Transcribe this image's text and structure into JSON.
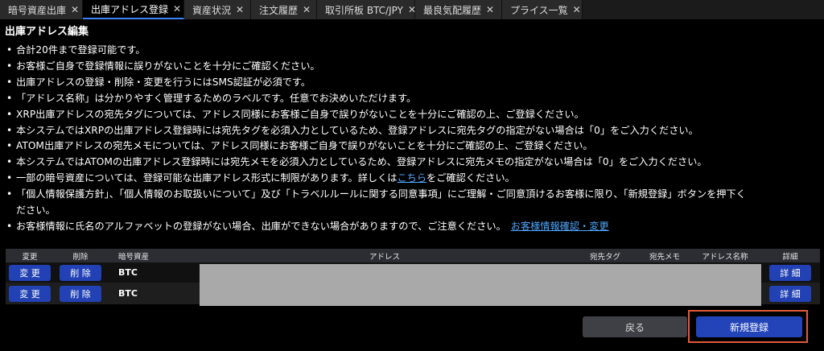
{
  "tabs": [
    {
      "label": "暗号資産出庫",
      "close": "✕",
      "active": false
    },
    {
      "label": "出庫アドレス登録",
      "close": "✕",
      "active": true
    },
    {
      "label": "資産状況",
      "close": "✕",
      "active": false
    },
    {
      "label": "注文履歴",
      "close": "✕",
      "active": false
    },
    {
      "label": "取引所板 BTC/JPY",
      "close": "✕",
      "active": false
    },
    {
      "label": "最良気配履歴",
      "close": "✕",
      "active": false
    },
    {
      "label": "プライス一覧",
      "close": "✕",
      "active": false
    }
  ],
  "title": "出庫アドレス編集",
  "notes": [
    "合計20件まで登録可能です。",
    "お客様ご自身で登録情報に誤りがないことを十分にご確認ください。",
    "出庫アドレスの登録・削除・変更を行うにはSMS認証が必須です。",
    "「アドレス名称」は分かりやすく管理するためのラベルです。任意でお決めいただけます。",
    "XRP出庫アドレスの宛先タグについては、アドレス同様にお客様ご自身で誤りがないことを十分にご確認の上、ご登録ください。",
    "本システムではXRPの出庫アドレス登録時には宛先タグを必須入力としているため、登録アドレスに宛先タグの指定がない場合は「0」をご入力ください。",
    "ATOM出庫アドレスの宛先メモについては、アドレス同様にお客様ご自身で誤りがないことを十分にご確認の上、ご登録ください。",
    "本システムではATOMの出庫アドレス登録時には宛先メモを必須入力としているため、登録アドレスに宛先メモの指定がない場合は「0」をご入力ください。"
  ],
  "note_link": {
    "before": "一部の暗号資産については、登録可能な出庫アドレス形式に制限があります。詳しくは",
    "link": "こちら",
    "after": "をご確認ください。"
  },
  "note_consent_1": "「個人情報保護方針」、「個人情報のお取扱いについて」及び「トラベルルールに関する同意事項」にご理解・ご同意頂けるお客様に限り、「新規登録」ボタンを押下く",
  "note_consent_2": "ださい。",
  "note_last": {
    "before": "お客様情報に氏名のアルファベットの登録がない場合、出庫ができない場合がありますので、ご注意ください。",
    "link": "お客様情報確認・変更"
  },
  "table": {
    "headers": [
      "変更",
      "削除",
      "暗号資産",
      "アドレス",
      "宛先タグ",
      "宛先メモ",
      "アドレス名称",
      "詳細"
    ],
    "rows": [
      {
        "change": "変 更",
        "delete": "削 除",
        "coin": "BTC",
        "detail": "詳 細"
      },
      {
        "change": "変 更",
        "delete": "削 除",
        "coin": "BTC",
        "detail": "詳 細"
      }
    ]
  },
  "buttons": {
    "back": "戻る",
    "register": "新規登録"
  }
}
